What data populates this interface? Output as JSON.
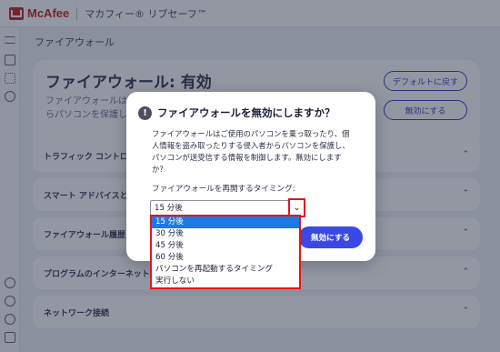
{
  "app": {
    "brand": "McAfee",
    "product": "マカフィー® リブセーフ™"
  },
  "page": {
    "title": "ファイアウォール",
    "hero_title": "ファイアウォール: 有効",
    "hero_desc_line1": "ファイアウォールは",
    "hero_desc_line2": "らパソコンを保護し、",
    "restore_default_label": "デフォルトに戻す",
    "disable_label": "無効にする"
  },
  "sections": [
    {
      "label": "トラフィック コントロー"
    },
    {
      "label": "スマート アドバイスと"
    },
    {
      "label": "ファイアウォール履歴"
    },
    {
      "label": "プログラムのインターネット接"
    },
    {
      "label": "ネットワーク接続"
    }
  ],
  "dialog": {
    "title": "ファイアウォールを無効にしますか？",
    "body_lines": [
      "ファイアウォールはご使用のパソコンを乗っ取ったり、個",
      "人情報を盗み取ったりする侵入者からパソコンを保護し、",
      "パソコンが送受信する情報を制御します。無効にします",
      "か？"
    ],
    "timing_label": "ファイアウォールを再開するタイミング:",
    "selected_value": "15 分後",
    "confirm_label": "無効にする"
  },
  "dropdown": {
    "options": [
      "15 分後",
      "30 分後",
      "45 分後",
      "60 分後",
      "パソコンを再起動するタイミング",
      "実行しない"
    ],
    "selected_index": 0
  },
  "colors": {
    "brand_red": "#c01818",
    "accent_blue": "#3b48e6",
    "highlight_red": "#e0161d",
    "selection_blue": "#1c7be3"
  }
}
